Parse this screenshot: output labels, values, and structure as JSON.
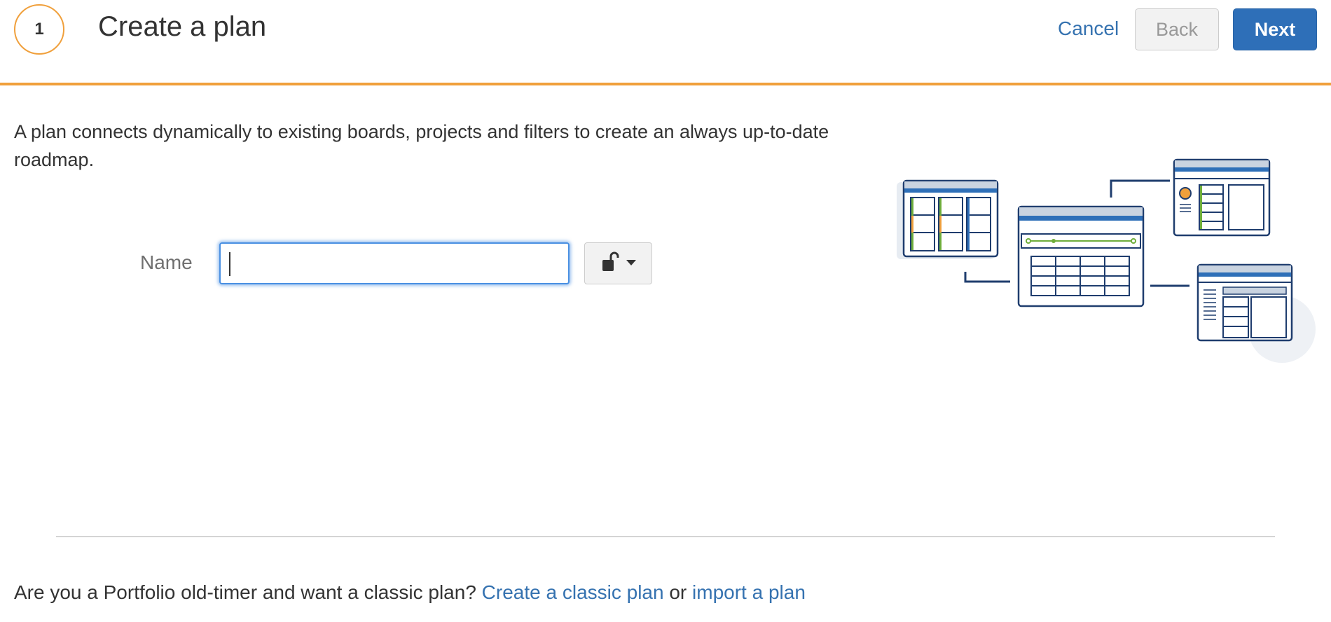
{
  "header": {
    "step_number": "1",
    "title": "Create a plan",
    "cancel_label": "Cancel",
    "back_label": "Back",
    "next_label": "Next"
  },
  "intro_text": "A plan connects dynamically to existing boards, projects and filters to create an always up-to-date roadmap.",
  "form": {
    "name_label": "Name",
    "name_value": "",
    "permission_icon": "unlock-icon",
    "dropdown_icon": "caret-down-icon"
  },
  "footer": {
    "question": "Are you a Portfolio old-timer and want a classic plan?",
    "classic_link": "Create a classic plan",
    "or_text": "or",
    "import_link": "import a plan"
  },
  "colors": {
    "accent_orange": "#f0a03c",
    "primary_blue": "#2e6fb8",
    "link_blue": "#3572b0",
    "navy_outline": "#1f3d6e"
  }
}
